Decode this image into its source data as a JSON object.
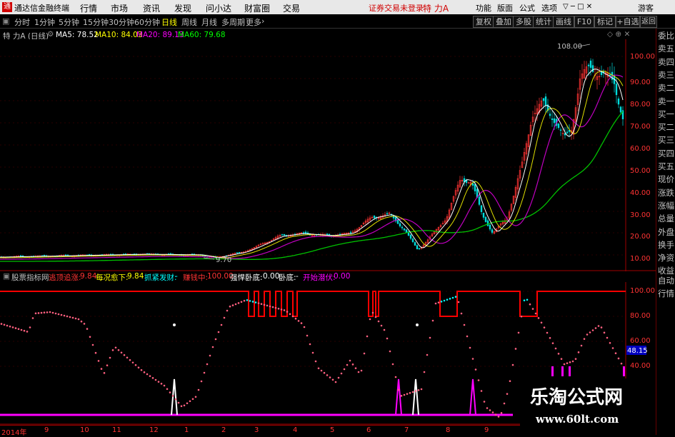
{
  "menubar": {
    "app_title": "通达信金融终端",
    "menus": [
      "行情",
      "市场",
      "资讯",
      "发现",
      "问小达",
      "财富圈",
      "交易"
    ],
    "notice": "证券交易未登录",
    "stock_name": "特 力A",
    "right_items": [
      "功能",
      "版面",
      "公式",
      "选项"
    ],
    "user": "游客"
  },
  "periodbar": {
    "periods": [
      "分时",
      "1分钟",
      "5分钟",
      "15分钟",
      "30分钟",
      "60分钟",
      "日线",
      "周线",
      "月线",
      "多周期",
      "更多"
    ],
    "active": "日线",
    "tools": [
      "复权",
      "叠加",
      "多股",
      "统计",
      "画线",
      "F10",
      "标记",
      "+自选",
      "返回"
    ]
  },
  "main_chart": {
    "title": "特 力A (日线)",
    "ma": [
      {
        "label": "MA5: 78.52",
        "color": "#ffffff"
      },
      {
        "label": "MA10: 84.03",
        "color": "#ffff00"
      },
      {
        "label": "MA20: 89.13",
        "color": "#ff00ff"
      },
      {
        "label": "MA60: 79.68",
        "color": "#00ff00"
      }
    ],
    "high_label": "108.00",
    "low_label": "9.70",
    "axis_ticks": [
      "100.00",
      "90.00",
      "80.00",
      "70.00",
      "60.00",
      "50.00",
      "40.00",
      "30.00",
      "20.00",
      "10.00"
    ]
  },
  "indicator": {
    "name": "股票指标网",
    "items": [
      {
        "label": "逃顶追涨:",
        "value": "9.84",
        "color": "#ff3333"
      },
      {
        "label": "每况愈下:",
        "value": "9.84",
        "color": "#ffff00"
      },
      {
        "label": "抓紧发财:",
        "value": "-",
        "color": "#00ffff"
      },
      {
        "label": "赚钱中:",
        "value": "100.00",
        "color": "#ff3333"
      },
      {
        "label": "强悍卧底:",
        "value": "0.00",
        "color": "#ffffff"
      },
      {
        "label": "卧底:",
        "value": "-",
        "color": "#ffffff"
      },
      {
        "label": "开始潜伏:",
        "value": "0.00",
        "color": "#ff00ff"
      }
    ],
    "axis_ticks": [
      "100.00",
      "80.00",
      "60.00",
      "40.00"
    ],
    "current": "48.15"
  },
  "date_axis": {
    "labels": [
      "2014年",
      "9",
      "10",
      "11",
      "12",
      "1",
      "2",
      "3",
      "4",
      "5",
      "6",
      "7",
      "8",
      "9"
    ]
  },
  "right_panel": {
    "top_items": [
      "委比",
      "卖五",
      "卖四",
      "卖三",
      "卖二",
      "卖一",
      "买一",
      "买二",
      "买三",
      "买四",
      "买五",
      "现价",
      "涨跌",
      "涨幅",
      "总量",
      "外盘",
      "换手",
      "净资",
      "收益"
    ],
    "bottom_items": [
      "自动",
      "行情"
    ]
  },
  "watermark": {
    "title": "乐淘公式网",
    "url": "www.60lt.com"
  },
  "colors": {
    "up": "#ff3333",
    "down": "#00ffff",
    "ma5": "#ffffff",
    "ma10": "#ffff00",
    "ma20": "#ff00ff",
    "ma60": "#00ff00"
  }
}
